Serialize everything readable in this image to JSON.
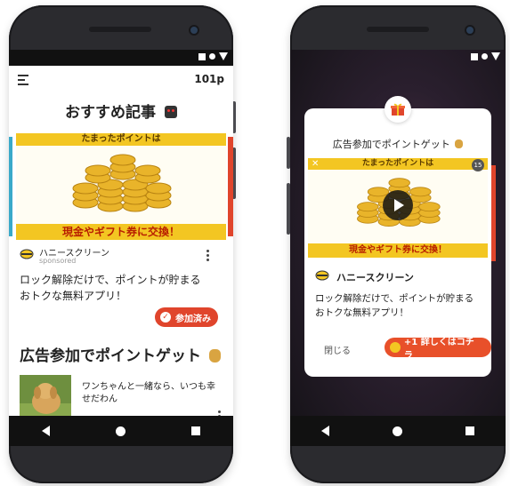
{
  "left_phone": {
    "points": "101p",
    "section1_title": "おすすめ記事",
    "banner": {
      "top_text": "たまったポイントは",
      "bottom_text": "現金やギフト券に交換！"
    },
    "card": {
      "brand": "ハニースクリーン",
      "sponsored": "sponsored",
      "description_line1": "ロック解除だけで、ポイントが貯まる",
      "description_line2": "おトクな無料アプリ！",
      "chip_label": "参加済み"
    },
    "section2_title": "広告参加でポイントゲット",
    "list_item": {
      "text_line1": "ワンちゃんと一緒なら、いつも幸",
      "text_line2": "せだわん"
    }
  },
  "right_phone": {
    "dialog": {
      "title": "広告参加でポイントゲット",
      "banner_top_text": "たまったポイントは",
      "banner_bottom_text": "現金やギフト券に交換！",
      "timer": "15",
      "brand": "ハニースクリーン",
      "description_line1": "ロック解除だけで、ポイントが貯まる",
      "description_line2": "おトクな無料アプリ！",
      "close_label": "閉じる",
      "cta_label": "+1 詳しくはコチラ"
    }
  },
  "icons": [
    "menu-icon",
    "robot-emoji-icon",
    "money-bag-icon",
    "gift-icon",
    "play-icon",
    "check-icon",
    "coin-icon",
    "more-vert-icon",
    "back-nav-icon",
    "home-nav-icon",
    "recents-nav-icon",
    "signal-icon",
    "wifi-icon",
    "battery-icon",
    "close-icon",
    "mute-icon",
    "expand-icon"
  ],
  "colors": {
    "accent_red": "#e0452c",
    "coin_gold": "#f3c622",
    "status_bar": "#111111"
  }
}
